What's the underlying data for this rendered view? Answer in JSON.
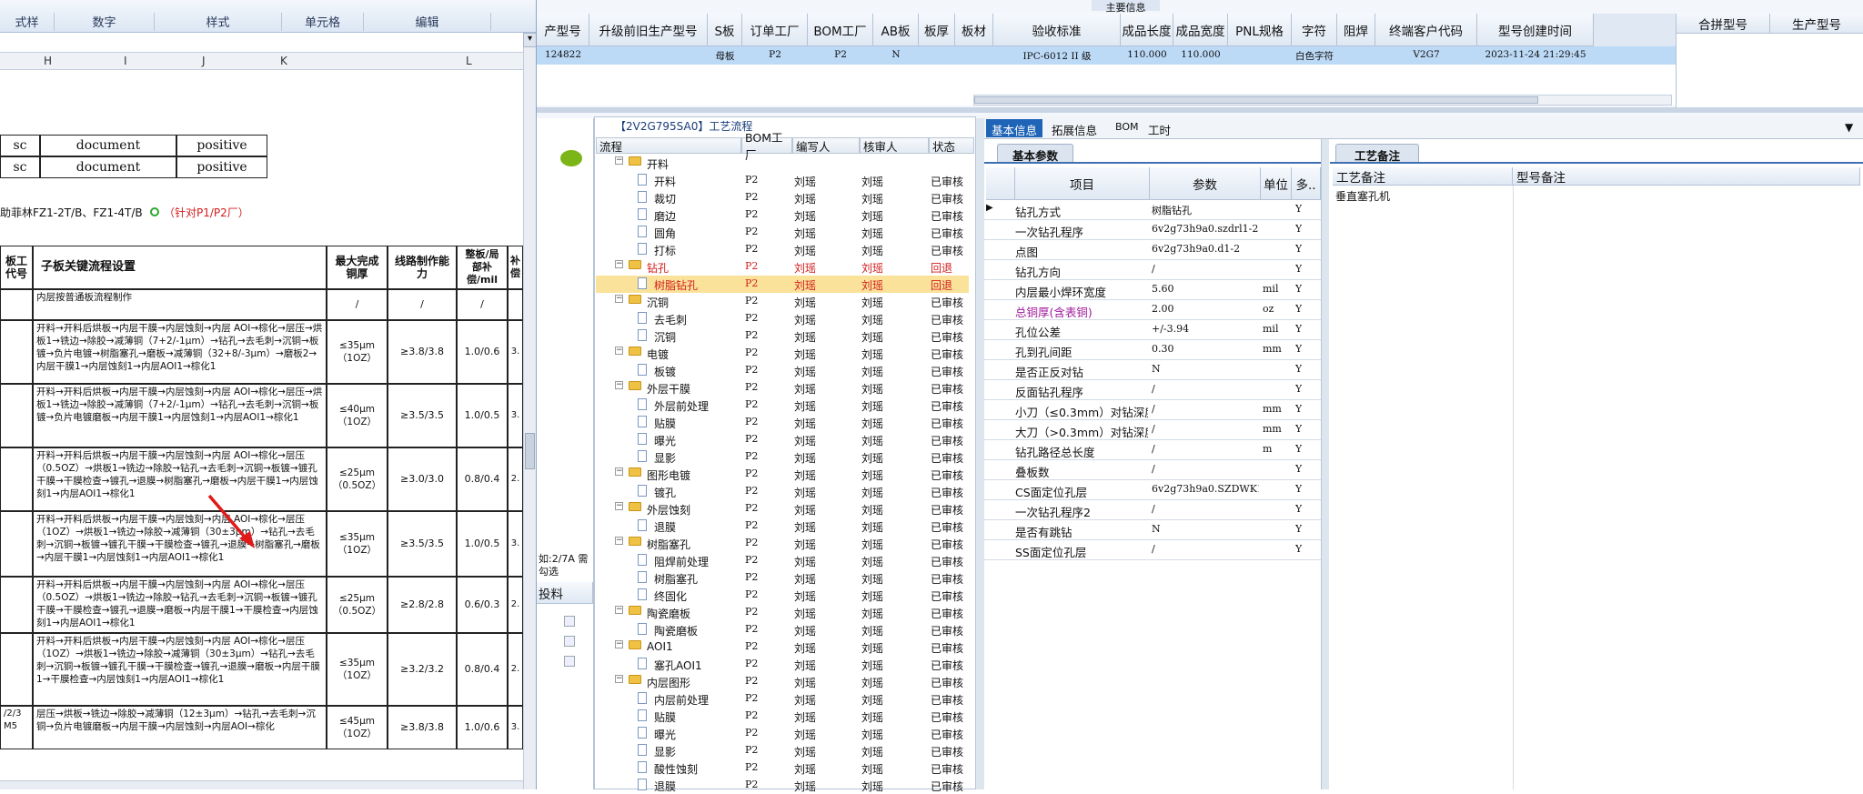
{
  "left_doc": {
    "ribbon_groups": [
      "式样",
      "数字",
      "样式",
      "单元格",
      "编辑"
    ],
    "col_letters": [
      "H",
      "I",
      "J",
      "K",
      "L"
    ],
    "row1": [
      "sc",
      "document",
      "positive"
    ],
    "row2": [
      "sc",
      "document",
      "positive"
    ],
    "note": "助菲林FZ1-2T/B、FZ1-4T/B",
    "note_red": "（针对P1/P2厂）",
    "headers": [
      "板工代号",
      "子板关键流程设置",
      "最大完成铜厚",
      "线路制作能力",
      "整板/局部补偿/mil",
      "补偿"
    ],
    "rows": [
      {
        "process": "内层按普通板流程制作",
        "cu": "/",
        "line": "/",
        "comp": "/"
      },
      {
        "process": "开料→开料后烘板→内层干膜→内层蚀刻→内层 AOI→棕化→层压→烘板1→铣边→除胶→减薄铜（7+2/-1μm）→钻孔→去毛刺→沉铜→板镀→负片电镀→树脂塞孔→磨板→减薄铜（32+8/-3μm）→磨板2→内层干膜1→内层蚀刻1→内层AOI1→棕化1",
        "cu": "≤35μm（1OZ）",
        "line": "≥3.8/3.8",
        "comp": "1.0/0.6",
        "x": "3."
      },
      {
        "process": "开料→开料后烘板→内层干膜→内层蚀刻→内层 AOI→棕化→层压→烘板1→铣边→除胶→减薄铜（7+2/-1μm）→钻孔→去毛刺→沉铜→板镀→负片电镀磨板→内层干膜1→内层蚀刻1→内层AOI1→棕化1",
        "cu": "≤40μm（1OZ）",
        "line": "≥3.5/3.5",
        "comp": "1.0/0.5",
        "x": "3."
      },
      {
        "process": "开料→开料后烘板→内层干膜→内层蚀刻→内层 AOI→棕化→层压（0.5OZ）→烘板1→铣边→除胶→钻孔→去毛刺→沉铜→板镀→镀孔干膜→干膜检查→镀孔→退膜→树脂塞孔→磨板→内层干膜1→内层蚀刻1→内层AOI1→棕化1",
        "cu": "≤25μm（0.5OZ）",
        "line": "≥3.0/3.0",
        "comp": "0.8/0.4",
        "x": "2."
      },
      {
        "process": "开料→开料后烘板→内层干膜→内层蚀刻→内层 AOI→棕化→层压（1OZ）→烘板1→铣边→除胶→减薄铜（30±3μm）→钻孔→去毛刺→沉铜→板镀→镀孔干膜→干膜检查→镀孔→退膜→树脂塞孔→磨板→内层干膜1→内层蚀刻1→内层AOI1→棕化1",
        "cu": "≤35μm（1OZ）",
        "line": "≥3.5/3.5",
        "comp": "1.0/0.5",
        "x": "3."
      },
      {
        "process": "开料→开料后烘板→内层干膜→内层蚀刻→内层 AOI→棕化→层压（0.5OZ）→烘板1→铣边→除胶→钻孔→去毛刺→沉铜→板镀→镀孔干膜→干膜检查→镀孔→退膜→磨板→内层干膜1→干膜检查→内层蚀刻1→内层AOI1→棕化1",
        "cu": "≤25μm（0.5OZ）",
        "line": "≥2.8/2.8",
        "comp": "0.6/0.3",
        "x": "2."
      },
      {
        "process": "开料→开料后烘板→内层干膜→内层蚀刻→内层 AOI→棕化→层压（1OZ）→烘板1→铣边→除胶→减薄铜（30±3μm）→钻孔→去毛刺→沉铜→板镀→镀孔干膜→干膜检查→镀孔→退膜→磨板→内层干膜1→干膜检查→内层蚀刻1→内层AOI1→棕化1",
        "cu": "≤35μm（1OZ）",
        "line": "≥3.2/3.2",
        "comp": "0.8/0.4",
        "x": "2."
      },
      {
        "code": "/2/3 M5",
        "process": "层压→烘板→铣边→除胶→减薄铜（12±3μm）→钻孔→去毛刺→沉铜→负片电镀磨板→内层干膜→内层蚀刻→内层AOI→棕化",
        "cu": "≤45μm（1OZ）",
        "line": "≥3.8/3.8",
        "comp": "1.0/0.6",
        "x": "3."
      }
    ]
  },
  "top_grid": {
    "headers": [
      "产型号",
      "升级前旧生产型号",
      "S板",
      "订单工厂",
      "BOM工厂",
      "AB板",
      "板厚",
      "板材",
      "验收标准",
      "成品长度",
      "成品宽度",
      "PNL规格",
      "字符",
      "阻焊",
      "终端客户代码",
      "型号创建时间"
    ],
    "row": [
      "124822",
      "",
      "母板",
      "P2",
      "P2",
      "N",
      "",
      "",
      "IPC-6012 II 级",
      "110.000",
      "110.000",
      "",
      "白色字符",
      "",
      "V2G7",
      "2023-11-24 21:29:45"
    ],
    "right_headers": [
      "合拼型号",
      "生产型号"
    ],
    "section_label": "主要信息"
  },
  "flow": {
    "title": "【2V2G795SA0】工艺流程",
    "side_note": "如:2/7A 需勾选",
    "side_col": "投料",
    "headers": [
      "流程",
      "BOM工厂",
      "编写人",
      "核审人",
      "状态"
    ],
    "items": [
      {
        "name": "开料",
        "level": 0,
        "factory": "",
        "writer": "",
        "reviewer": "",
        "status": ""
      },
      {
        "name": "开料",
        "level": 1,
        "factory": "P2",
        "writer": "刘瑶",
        "reviewer": "刘瑶",
        "status": "已审核"
      },
      {
        "name": "裁切",
        "level": 1,
        "factory": "P2",
        "writer": "刘瑶",
        "reviewer": "刘瑶",
        "status": "已审核"
      },
      {
        "name": "磨边",
        "level": 1,
        "factory": "P2",
        "writer": "刘瑶",
        "reviewer": "刘瑶",
        "status": "已审核"
      },
      {
        "name": "圆角",
        "level": 1,
        "factory": "P2",
        "writer": "刘瑶",
        "reviewer": "刘瑶",
        "status": "已审核"
      },
      {
        "name": "打标",
        "level": 1,
        "factory": "P2",
        "writer": "刘瑶",
        "reviewer": "刘瑶",
        "status": "已审核"
      },
      {
        "name": "钻孔",
        "level": 0,
        "factory": "P2",
        "writer": "刘瑶",
        "reviewer": "刘瑶",
        "status": "回退",
        "red": true
      },
      {
        "name": "树脂钻孔",
        "level": 1,
        "factory": "P2",
        "writer": "刘瑶",
        "reviewer": "刘瑶",
        "status": "回退",
        "red": true,
        "sel": true
      },
      {
        "name": "沉铜",
        "level": 0,
        "factory": "P2",
        "writer": "刘瑶",
        "reviewer": "刘瑶",
        "status": "已审核"
      },
      {
        "name": "去毛刺",
        "level": 1,
        "factory": "P2",
        "writer": "刘瑶",
        "reviewer": "刘瑶",
        "status": "已审核"
      },
      {
        "name": "沉铜",
        "level": 1,
        "factory": "P2",
        "writer": "刘瑶",
        "reviewer": "刘瑶",
        "status": "已审核"
      },
      {
        "name": "电镀",
        "level": 0,
        "factory": "P2",
        "writer": "刘瑶",
        "reviewer": "刘瑶",
        "status": "已审核"
      },
      {
        "name": "板镀",
        "level": 1,
        "factory": "P2",
        "writer": "刘瑶",
        "reviewer": "刘瑶",
        "status": "已审核"
      },
      {
        "name": "外层干膜",
        "level": 0,
        "factory": "P2",
        "writer": "刘瑶",
        "reviewer": "刘瑶",
        "status": "已审核"
      },
      {
        "name": "外层前处理",
        "level": 1,
        "factory": "P2",
        "writer": "刘瑶",
        "reviewer": "刘瑶",
        "status": "已审核"
      },
      {
        "name": "贴膜",
        "level": 1,
        "factory": "P2",
        "writer": "刘瑶",
        "reviewer": "刘瑶",
        "status": "已审核"
      },
      {
        "name": "曝光",
        "level": 1,
        "factory": "P2",
        "writer": "刘瑶",
        "reviewer": "刘瑶",
        "status": "已审核"
      },
      {
        "name": "显影",
        "level": 1,
        "factory": "P2",
        "writer": "刘瑶",
        "reviewer": "刘瑶",
        "status": "已审核"
      },
      {
        "name": "图形电镀",
        "level": 0,
        "factory": "P2",
        "writer": "刘瑶",
        "reviewer": "刘瑶",
        "status": "已审核"
      },
      {
        "name": "镀孔",
        "level": 1,
        "factory": "P2",
        "writer": "刘瑶",
        "reviewer": "刘瑶",
        "status": "已审核"
      },
      {
        "name": "外层蚀刻",
        "level": 0,
        "factory": "P2",
        "writer": "刘瑶",
        "reviewer": "刘瑶",
        "status": "已审核"
      },
      {
        "name": "退膜",
        "level": 1,
        "factory": "P2",
        "writer": "刘瑶",
        "reviewer": "刘瑶",
        "status": "已审核"
      },
      {
        "name": "树脂塞孔",
        "level": 0,
        "factory": "P2",
        "writer": "刘瑶",
        "reviewer": "刘瑶",
        "status": "已审核"
      },
      {
        "name": "阻焊前处理",
        "level": 1,
        "factory": "P2",
        "writer": "刘瑶",
        "reviewer": "刘瑶",
        "status": "已审核"
      },
      {
        "name": "树脂塞孔",
        "level": 1,
        "factory": "P2",
        "writer": "刘瑶",
        "reviewer": "刘瑶",
        "status": "已审核"
      },
      {
        "name": "终固化",
        "level": 1,
        "factory": "P2",
        "writer": "刘瑶",
        "reviewer": "刘瑶",
        "status": "已审核"
      },
      {
        "name": "陶瓷磨板",
        "level": 0,
        "factory": "P2",
        "writer": "刘瑶",
        "reviewer": "刘瑶",
        "status": "已审核"
      },
      {
        "name": "陶瓷磨板",
        "level": 1,
        "factory": "P2",
        "writer": "刘瑶",
        "reviewer": "刘瑶",
        "status": "已审核"
      },
      {
        "name": "AOI1",
        "level": 0,
        "factory": "P2",
        "writer": "刘瑶",
        "reviewer": "刘瑶",
        "status": "已审核"
      },
      {
        "name": "塞孔AOI1",
        "level": 1,
        "factory": "P2",
        "writer": "刘瑶",
        "reviewer": "刘瑶",
        "status": "已审核"
      },
      {
        "name": "内层图形",
        "level": 0,
        "factory": "P2",
        "writer": "刘瑶",
        "reviewer": "刘瑶",
        "status": "已审核"
      },
      {
        "name": "内层前处理",
        "level": 1,
        "factory": "P2",
        "writer": "刘瑶",
        "reviewer": "刘瑶",
        "status": "已审核"
      },
      {
        "name": "贴膜",
        "level": 1,
        "factory": "P2",
        "writer": "刘瑶",
        "reviewer": "刘瑶",
        "status": "已审核"
      },
      {
        "name": "曝光",
        "level": 1,
        "factory": "P2",
        "writer": "刘瑶",
        "reviewer": "刘瑶",
        "status": "已审核"
      },
      {
        "name": "显影",
        "level": 1,
        "factory": "P2",
        "writer": "刘瑶",
        "reviewer": "刘瑶",
        "status": "已审核"
      },
      {
        "name": "酸性蚀刻",
        "level": 1,
        "factory": "P2",
        "writer": "刘瑶",
        "reviewer": "刘瑶",
        "status": "已审核"
      },
      {
        "name": "退膜",
        "level": 1,
        "factory": "P2",
        "writer": "刘瑶",
        "reviewer": "刘瑶",
        "status": "已审核"
      }
    ]
  },
  "info": {
    "tabs": [
      "基本信息",
      "拓展信息",
      "BOM",
      "工时"
    ],
    "subtab": "基本参数",
    "headers": [
      "项目",
      "参数",
      "单位",
      "多.."
    ],
    "rows": [
      {
        "item": "钻孔方式",
        "param": "树脂钻孔",
        "unit": "",
        "flag": "Y"
      },
      {
        "item": "一次钻孔程序",
        "param": "6v2g73h9a0.szdrl1-2",
        "unit": "",
        "flag": "Y"
      },
      {
        "item": "点图",
        "param": "6v2g73h9a0.d1-2",
        "unit": "",
        "flag": "Y"
      },
      {
        "item": "钻孔方向",
        "param": "/",
        "unit": "",
        "flag": "Y"
      },
      {
        "item": "内层最小焊环宽度",
        "param": "5.60",
        "unit": "mil",
        "flag": "Y"
      },
      {
        "item": "总铜厚(含表铜)",
        "param": "2.00",
        "unit": "oz",
        "flag": "Y",
        "purple": true
      },
      {
        "item": "孔位公差",
        "param": "+/-3.94",
        "unit": "mil",
        "flag": "Y"
      },
      {
        "item": "孔到孔间距",
        "param": "0.30",
        "unit": "mm",
        "flag": "Y"
      },
      {
        "item": "是否正反对钻",
        "param": "N",
        "unit": "",
        "flag": "Y"
      },
      {
        "item": "反面钻孔程序",
        "param": "/",
        "unit": "",
        "flag": "Y"
      },
      {
        "item": "小刀（≤0.3mm）对钻深度",
        "param": "/",
        "unit": "mm",
        "flag": "Y"
      },
      {
        "item": "大刀（>0.3mm）对钻深度",
        "param": "/",
        "unit": "mm",
        "flag": "Y"
      },
      {
        "item": "钻孔路径总长度",
        "param": "/",
        "unit": "m",
        "flag": "Y"
      },
      {
        "item": "叠板数",
        "param": "/",
        "unit": "",
        "flag": "Y"
      },
      {
        "item": "CS面定位孔层",
        "param": "6v2g73h9a0.SZDWK1-2",
        "unit": "",
        "flag": "Y"
      },
      {
        "item": "一次钻孔程序2",
        "param": "/",
        "unit": "",
        "flag": "Y"
      },
      {
        "item": "是否有跳钻",
        "param": "N",
        "unit": "",
        "flag": "Y"
      },
      {
        "item": "SS面定位孔层",
        "param": "/",
        "unit": "",
        "flag": "Y"
      }
    ],
    "remark_tab": "工艺备注",
    "remark_headers": [
      "工艺备注",
      "型号备注"
    ],
    "remark_value": "垂直塞孔机"
  },
  "colors": {
    "header_bg": "#dfe8f3",
    "selected": "#bcd9f6",
    "highlight": "#fbe29a",
    "red": "#d21d1d",
    "purple": "#a01a9c"
  }
}
